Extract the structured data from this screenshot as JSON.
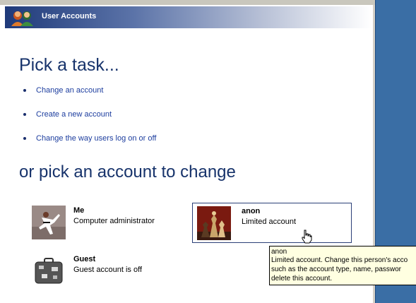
{
  "window": {
    "title": "User Accounts"
  },
  "tasks": {
    "heading": "Pick a task...",
    "items": [
      {
        "label": "Change an account"
      },
      {
        "label": "Create a new account"
      },
      {
        "label": "Change the way users log on or off"
      }
    ]
  },
  "accounts": {
    "heading": "or pick an account to change",
    "items": [
      {
        "name": "Me",
        "type": "Computer administrator"
      },
      {
        "name": "anon",
        "type": "Limited account"
      },
      {
        "name": "Guest",
        "type": "Guest account is off"
      }
    ]
  },
  "tooltip": {
    "lines": [
      "anon",
      "Limited account. Change this person's acco",
      "such as the account type, name, passwor",
      "delete this account."
    ]
  },
  "colors": {
    "heading": "#17336b",
    "link": "#1c3d9e",
    "desktop": "#3a6ea5",
    "tooltip_bg": "#ffffe1"
  }
}
